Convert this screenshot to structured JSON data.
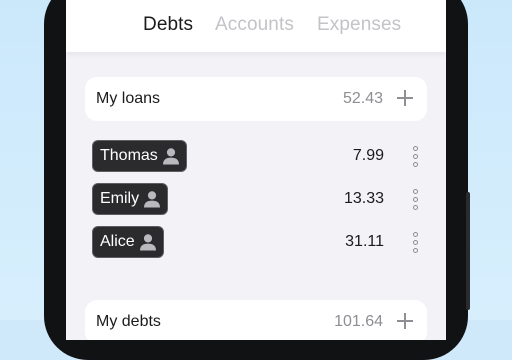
{
  "tabs": [
    {
      "label": "Debts",
      "active": true
    },
    {
      "label": "Accounts",
      "active": false
    },
    {
      "label": "Expenses",
      "active": false
    }
  ],
  "my_loans": {
    "title": "My loans",
    "amount": "52.43",
    "items": [
      {
        "name": "Thomas",
        "value": "7.99"
      },
      {
        "name": "Emily",
        "value": "13.33"
      },
      {
        "name": "Alice",
        "value": "31.11"
      }
    ]
  },
  "my_debts": {
    "title": "My debts",
    "amount": "101.64"
  },
  "colors": {
    "background": "#cfe9fb",
    "chip": "#2b2b2e",
    "muted": "#8e8e93"
  },
  "icons": {
    "add": "plus-icon",
    "person": "person-icon",
    "more": "more-vertical-icon"
  }
}
